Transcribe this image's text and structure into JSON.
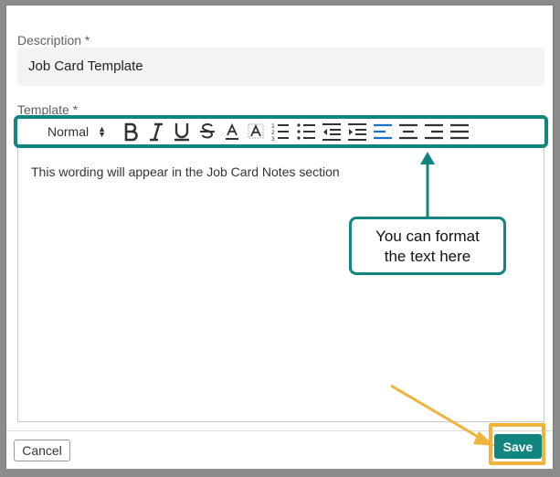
{
  "form": {
    "description_label": "Description *",
    "description_value": "Job Card Template",
    "template_label": "Template *",
    "template_text": "This wording will appear in the Job Card Notes section"
  },
  "toolbar": {
    "format_value": "Normal",
    "icons": [
      "bold-icon",
      "italic-icon",
      "underline-icon",
      "strikethrough-icon",
      "font-color-icon",
      "background-color-icon",
      "ordered-list-icon",
      "bullet-list-icon",
      "outdent-icon",
      "indent-icon",
      "align-left-icon",
      "align-center-icon",
      "align-right-icon",
      "align-justify-icon"
    ]
  },
  "annotation": {
    "line1": "You can format",
    "line2": "the text here"
  },
  "footer": {
    "cancel_label": "Cancel",
    "save_label": "Save"
  },
  "colors": {
    "accent": "#11857f",
    "highlight": "#f0b43a"
  }
}
